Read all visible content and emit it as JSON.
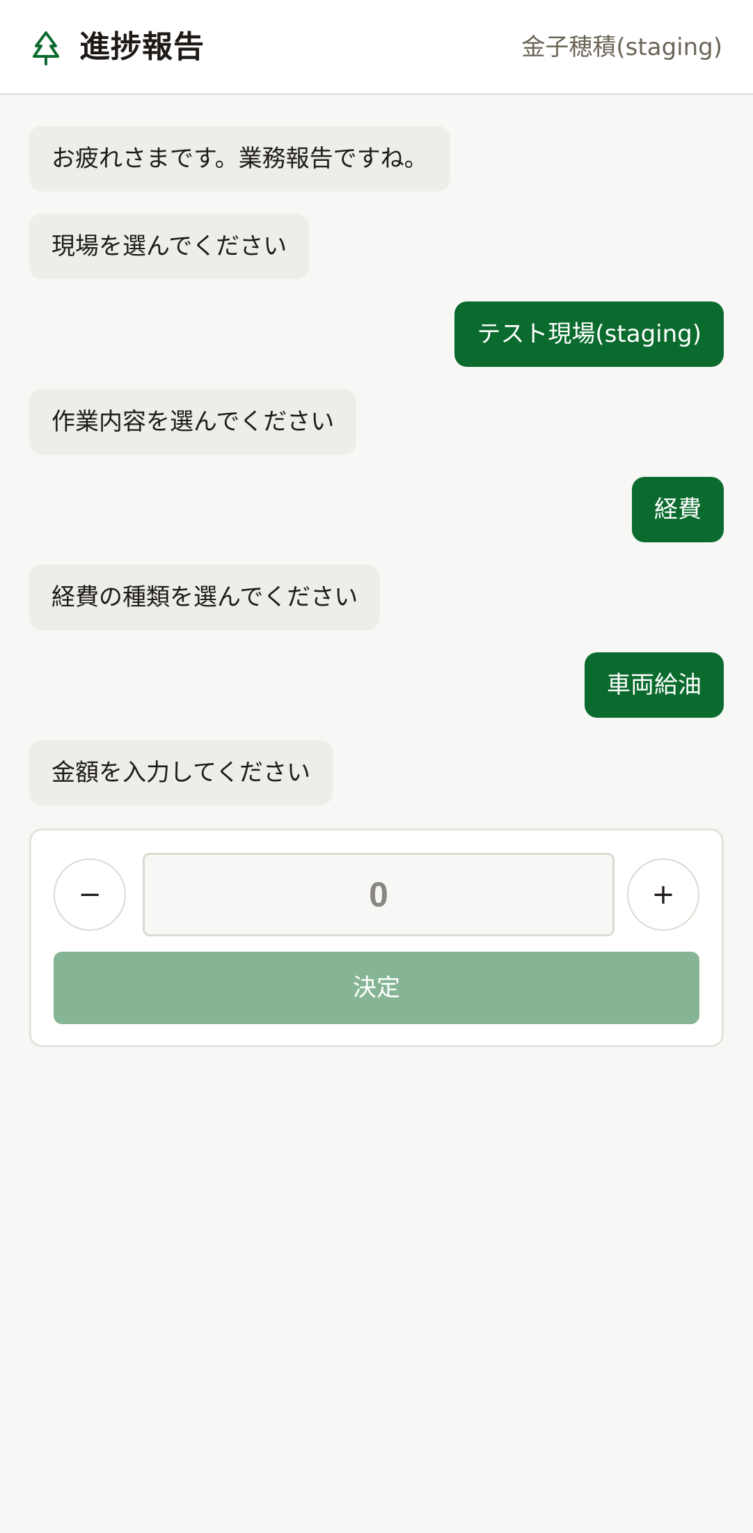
{
  "header": {
    "logo_icon": "tree-icon",
    "title": "進捗報告",
    "user": "金子穂積(staging)"
  },
  "messages": [
    {
      "from": "bot",
      "text": "お疲れさまです。業務報告ですね。"
    },
    {
      "from": "bot",
      "text": "現場を選んでください"
    },
    {
      "from": "user",
      "text": "テスト現場(staging)"
    },
    {
      "from": "bot",
      "text": "作業内容を選んでください"
    },
    {
      "from": "user",
      "text": "経費"
    },
    {
      "from": "bot",
      "text": "経費の種類を選んでください"
    },
    {
      "from": "user",
      "text": "車両給油"
    },
    {
      "from": "bot",
      "text": "金額を入力してください"
    }
  ],
  "amount_input": {
    "value": "0",
    "decrement_label": "−",
    "increment_label": "+",
    "submit_label": "決定"
  },
  "colors": {
    "accent": "#0b6b2e",
    "submit_disabled": "#86b595",
    "bot_bubble": "#eceee8"
  }
}
